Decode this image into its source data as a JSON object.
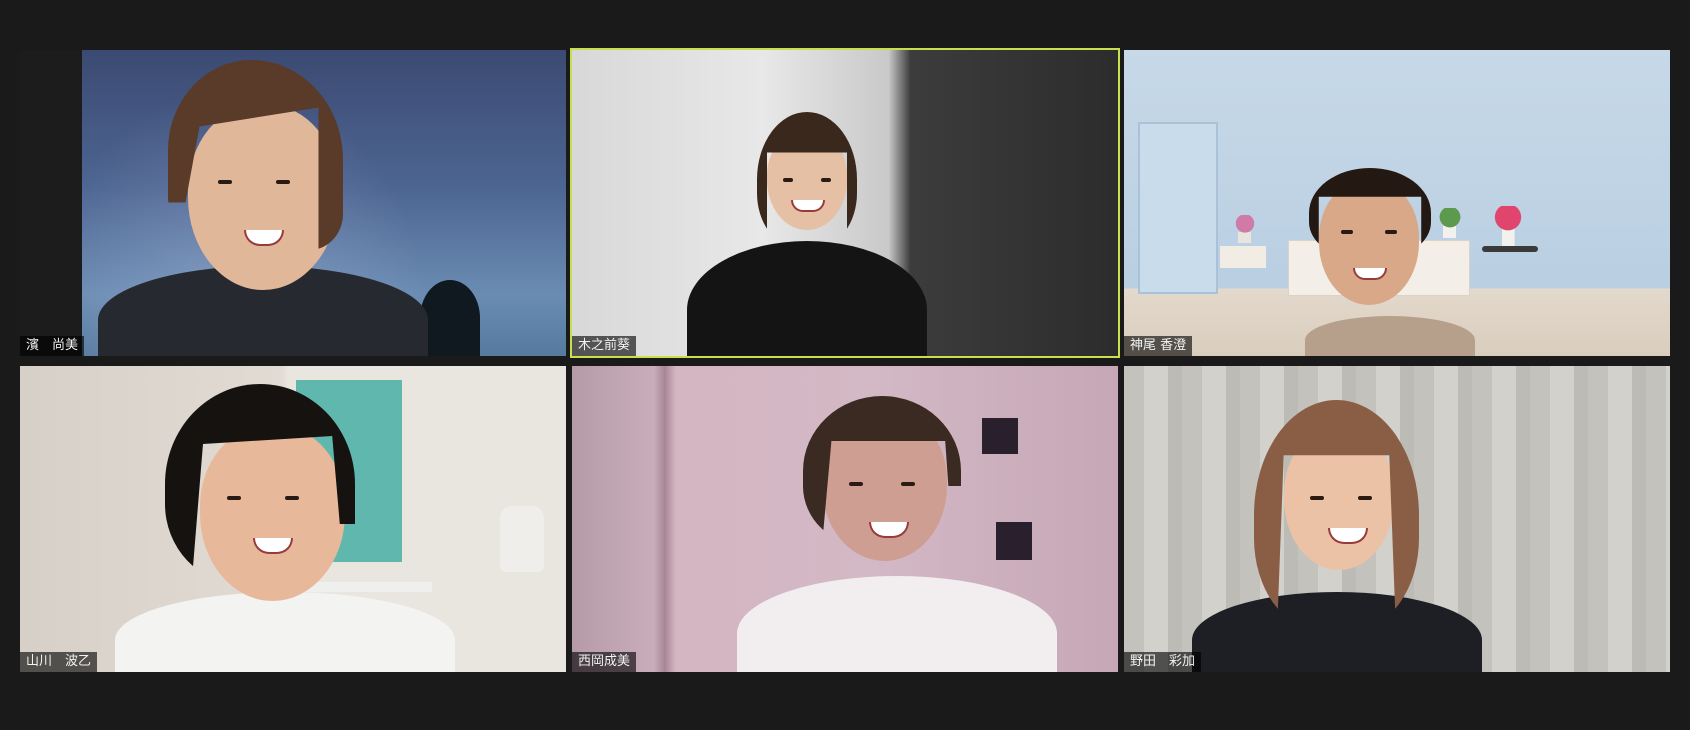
{
  "meeting": {
    "participants": [
      {
        "name": "濱　尚美",
        "active": false
      },
      {
        "name": "木之前葵",
        "active": true
      },
      {
        "name": "神尾 香澄",
        "active": false
      },
      {
        "name": "山川　波乙",
        "active": false
      },
      {
        "name": "西岡成美",
        "active": false
      },
      {
        "name": "野田　彩加",
        "active": false
      }
    ]
  },
  "colors": {
    "background": "#1a1a1a",
    "active_speaker_border": "#c8e04e",
    "name_label_bg": "rgba(0,0,0,0.62)"
  }
}
